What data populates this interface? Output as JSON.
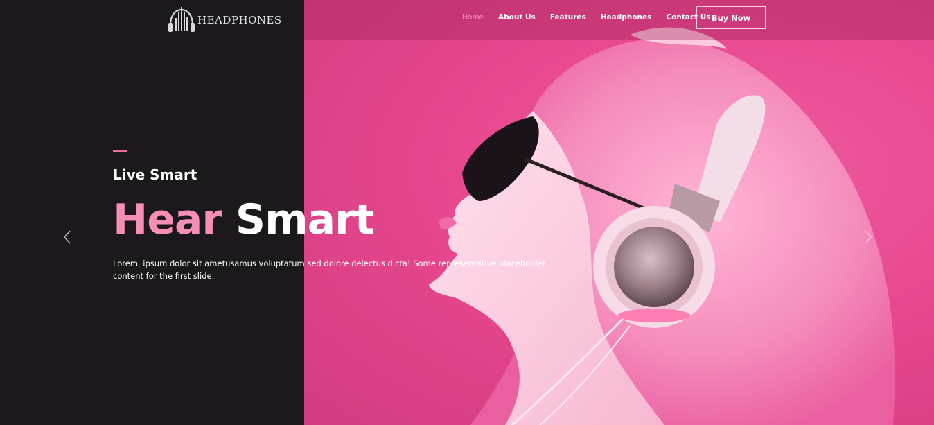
{
  "brand": {
    "name": "HEADPHONES",
    "logo_icon": "headphones-equalizer-icon"
  },
  "nav": {
    "items": [
      {
        "label": "Home",
        "active": true
      },
      {
        "label": "About Us",
        "active": false
      },
      {
        "label": "Features",
        "active": false
      },
      {
        "label": "Headphones",
        "active": false
      },
      {
        "label": "Contact Us",
        "active": false
      }
    ],
    "cta_label": "Buy Now"
  },
  "hero": {
    "kicker": "Live Smart",
    "headline_word1": "Hear",
    "headline_word2": "Smart",
    "lead": "Lorem, ipsum dolor sit ametusamus voluptatum sed dolore delectus dicta! Some representative placeholder content for the first slide.",
    "image": "woman-with-pink-hair-wearing-headphones-photo"
  },
  "carousel": {
    "prev_icon": "chevron-left-icon",
    "next_icon": "chevron-right-icon"
  },
  "colors": {
    "dark_panel": "#1b191b",
    "accent_pink": "#f2699f",
    "headline_pink": "#f78eb6",
    "photo_bg": "#e8488f"
  }
}
